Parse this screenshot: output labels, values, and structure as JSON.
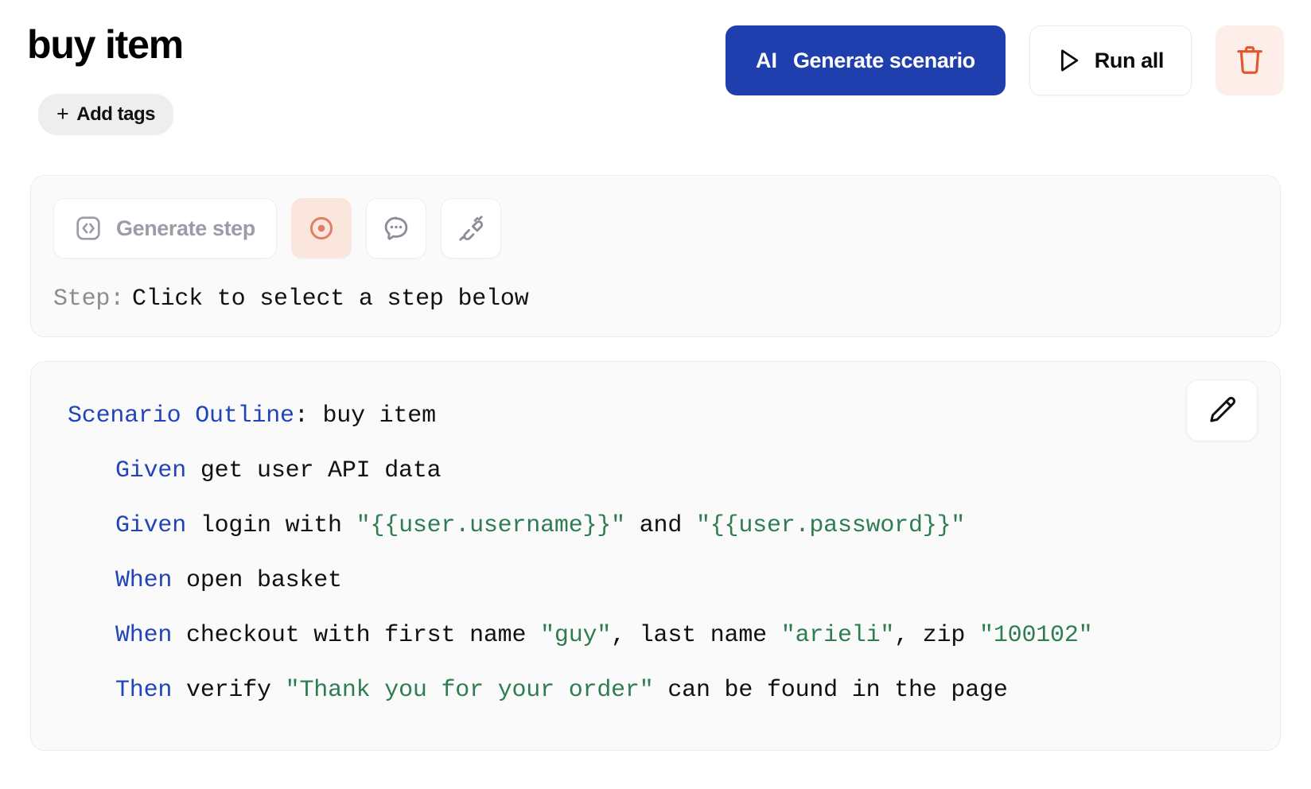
{
  "header": {
    "title": "buy item",
    "generate_scenario": {
      "ai_label": "AI",
      "label": "Generate scenario",
      "color": "#1e3fad"
    },
    "run_all_label": "Run all",
    "delete_color": "#e2562d",
    "delete_bg": "#fdeeea"
  },
  "tags": {
    "add_label": "Add tags",
    "plus": "+"
  },
  "step_panel": {
    "generate_step_label": "Generate step",
    "record_color": "#dd8063",
    "record_bg": "#fbe6de",
    "step_label": "Step:",
    "step_value": "Click to select a step below"
  },
  "scenario": {
    "lines": [
      {
        "indent": false,
        "parts": [
          {
            "text": "Scenario Outline",
            "style": "kw"
          },
          {
            "text": ": buy item",
            "style": "plain"
          }
        ]
      },
      {
        "indent": true,
        "parts": [
          {
            "text": "Given",
            "style": "kw"
          },
          {
            "text": " get user API data",
            "style": "plain"
          }
        ]
      },
      {
        "indent": true,
        "parts": [
          {
            "text": "Given",
            "style": "kw"
          },
          {
            "text": " login with ",
            "style": "plain"
          },
          {
            "text": "\"{{user.username}}\"",
            "style": "str"
          },
          {
            "text": " and ",
            "style": "plain"
          },
          {
            "text": "\"{{user.password}}\"",
            "style": "str"
          }
        ]
      },
      {
        "indent": true,
        "parts": [
          {
            "text": "When",
            "style": "kw"
          },
          {
            "text": " open basket",
            "style": "plain"
          }
        ]
      },
      {
        "indent": true,
        "parts": [
          {
            "text": "When",
            "style": "kw"
          },
          {
            "text": " checkout with first name ",
            "style": "plain"
          },
          {
            "text": "\"guy\"",
            "style": "str"
          },
          {
            "text": ", last name ",
            "style": "plain"
          },
          {
            "text": "\"arieli\"",
            "style": "str"
          },
          {
            "text": ", zip ",
            "style": "plain"
          },
          {
            "text": "\"100102\"",
            "style": "str"
          }
        ]
      },
      {
        "indent": true,
        "parts": [
          {
            "text": "Then",
            "style": "kw"
          },
          {
            "text": " verify ",
            "style": "plain"
          },
          {
            "text": "\"Thank you for your order\"",
            "style": "str"
          },
          {
            "text": " can be found in the page",
            "style": "plain"
          }
        ]
      }
    ],
    "keyword_color": "#2244bb",
    "string_color": "#2e7d52"
  }
}
